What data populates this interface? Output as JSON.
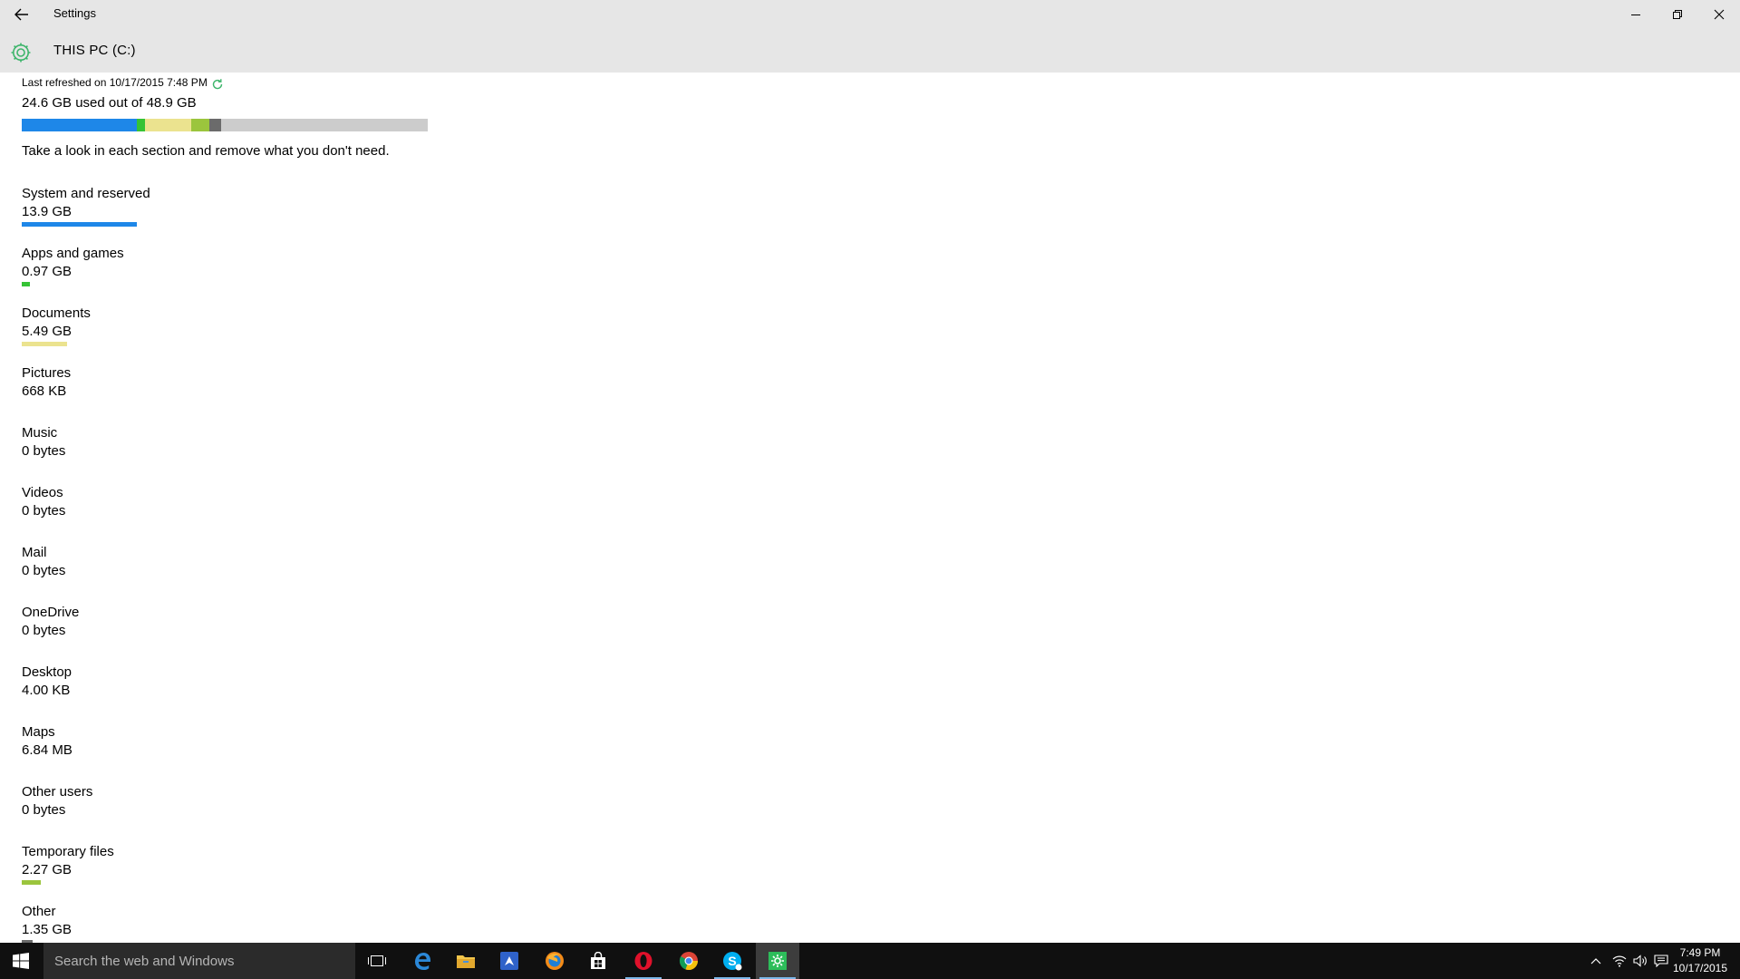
{
  "window": {
    "title": "Settings",
    "page_title": "THIS PC (C:)"
  },
  "storage": {
    "last_refreshed": "Last refreshed on 10/17/2015 7:48 PM",
    "used_summary": "24.6 GB used out of 48.9 GB",
    "used_gb": 24.6,
    "total_gb": 48.9,
    "hint": "Take a look in each section and remove what you don't need.",
    "usage_segments": [
      {
        "category": "System and reserved",
        "gb": 13.9,
        "color": "#1e87e8"
      },
      {
        "category": "Apps and games",
        "gb": 0.97,
        "color": "#35c335"
      },
      {
        "category": "Documents",
        "gb": 5.49,
        "color": "#ebe38f"
      },
      {
        "category": "Temporary files",
        "gb": 2.27,
        "color": "#9bc53d"
      },
      {
        "category": "Other",
        "gb": 1.35,
        "color": "#6b6b6b"
      }
    ],
    "categories": [
      {
        "name": "System and reserved",
        "size": "13.9 GB",
        "bar_fraction": 0.2843,
        "color": "#1e87e8"
      },
      {
        "name": "Apps and games",
        "size": "0.97 GB",
        "bar_fraction": 0.0198,
        "color": "#35c335"
      },
      {
        "name": "Documents",
        "size": "5.49 GB",
        "bar_fraction": 0.1123,
        "color": "#ebe38f"
      },
      {
        "name": "Pictures",
        "size": "668 KB",
        "bar_fraction": 0,
        "color": "#cccccc"
      },
      {
        "name": "Music",
        "size": "0 bytes",
        "bar_fraction": 0,
        "color": "#cccccc"
      },
      {
        "name": "Videos",
        "size": "0 bytes",
        "bar_fraction": 0,
        "color": "#cccccc"
      },
      {
        "name": "Mail",
        "size": "0 bytes",
        "bar_fraction": 0,
        "color": "#cccccc"
      },
      {
        "name": "OneDrive",
        "size": "0 bytes",
        "bar_fraction": 0,
        "color": "#cccccc"
      },
      {
        "name": "Desktop",
        "size": "4.00 KB",
        "bar_fraction": 0,
        "color": "#cccccc"
      },
      {
        "name": "Maps",
        "size": "6.84 MB",
        "bar_fraction": 0,
        "color": "#cccccc"
      },
      {
        "name": "Other users",
        "size": "0 bytes",
        "bar_fraction": 0,
        "color": "#cccccc"
      },
      {
        "name": "Temporary files",
        "size": "2.27 GB",
        "bar_fraction": 0.0464,
        "color": "#9bc53d"
      },
      {
        "name": "Other",
        "size": "1.35 GB",
        "bar_fraction": 0.0276,
        "color": "#6b6b6b"
      }
    ]
  },
  "taskbar": {
    "search_placeholder": "Search the web and Windows",
    "time": "7:49 PM",
    "date": "10/17/2015",
    "apps": [
      {
        "icon": "task-view-icon"
      },
      {
        "icon": "edge-icon"
      },
      {
        "icon": "file-explorer-icon"
      },
      {
        "icon": "app-icon"
      },
      {
        "icon": "firefox-icon"
      },
      {
        "icon": "store-icon"
      },
      {
        "icon": "opera-icon"
      },
      {
        "icon": "chrome-icon"
      },
      {
        "icon": "skype-icon"
      },
      {
        "icon": "settings-icon"
      }
    ]
  },
  "colors": {
    "accent": "#1e87e8",
    "header_bg": "#e6e6e6",
    "taskbar_bg": "#101010",
    "settings_green": "#3db56b"
  }
}
